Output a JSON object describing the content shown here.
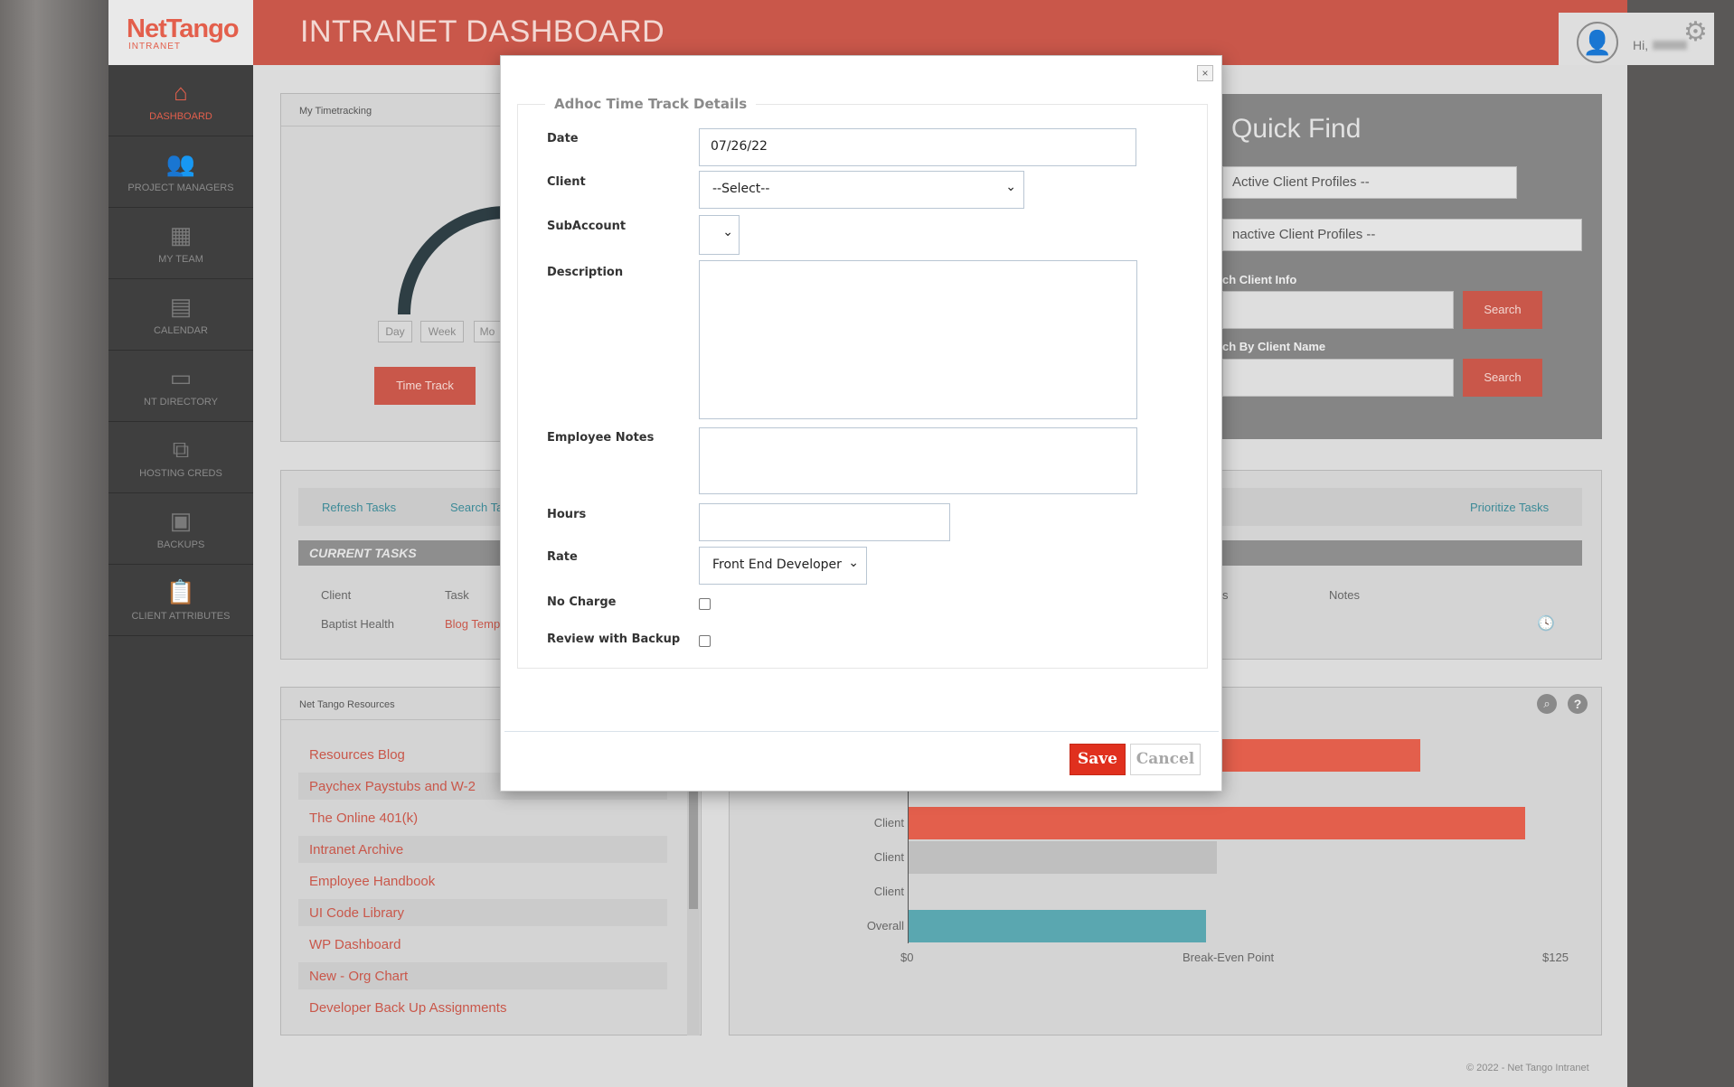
{
  "brand": {
    "logo": "NetTango",
    "logo_sub": "INTRANET"
  },
  "header": {
    "title": "INTRANET DASHBOARD",
    "greeting": "Hi,"
  },
  "sidebar": {
    "items": [
      {
        "label": "DASHBOARD",
        "icon": "home-icon"
      },
      {
        "label": "PROJECT MANAGERS",
        "icon": "people-icon"
      },
      {
        "label": "MY TEAM",
        "icon": "grid-icon"
      },
      {
        "label": "CALENDAR",
        "icon": "calendar-icon"
      },
      {
        "label": "NT DIRECTORY",
        "icon": "directory-icon"
      },
      {
        "label": "HOSTING CREDS",
        "icon": "network-icon"
      },
      {
        "label": "BACKUPS",
        "icon": "save-icon"
      },
      {
        "label": "CLIENT ATTRIBUTES",
        "icon": "clipboard-icon"
      }
    ]
  },
  "timetracking": {
    "title": "My Timetracking",
    "filters": [
      "Day",
      "Week",
      "Mo"
    ],
    "time_track_button": "Time Track"
  },
  "quick_find": {
    "title": "Quick Find",
    "active_select": "Active Client Profiles --",
    "inactive_select": "nactive Client Profiles --",
    "search_info_label": "ch Client Info",
    "search_name_label": "ch By Client Name",
    "search_button": "Search"
  },
  "tasks": {
    "refresh": "Refresh Tasks",
    "search": "Search Ta",
    "prioritize": "Prioritize Tasks",
    "current_title": "CURRENT TASKS",
    "columns": [
      "Client",
      "Task",
      "s",
      "Notes"
    ],
    "row": {
      "client": "Baptist Health",
      "task": "Blog Temp"
    }
  },
  "resources": {
    "title": "Net Tango Resources",
    "links": [
      "Resources Blog",
      "Paychex Paystubs and W-2",
      "The Online 401(k)",
      "Intranet Archive",
      "Employee Handbook",
      "UI Code Library",
      "WP Dashboard",
      "New - Org Chart",
      "Developer Back Up Assignments"
    ]
  },
  "chart_data": {
    "type": "bar",
    "orientation": "horizontal",
    "categories": [
      "Client",
      "Client",
      "Client",
      "Overall"
    ],
    "values": [
      118,
      59,
      0,
      57
    ],
    "top_bar_partial_value": 98,
    "colors": [
      "#e35f4c",
      "#bfbfbf",
      "#bfbfbf",
      "#5aa7b0"
    ],
    "x_tick_labels": [
      "$0",
      "Break-Even Point",
      "$125"
    ],
    "xlim": [
      0,
      125
    ]
  },
  "footer": {
    "copyright": "© 2022 - Net Tango Intranet"
  },
  "modal": {
    "legend": "Adhoc Time Track Details",
    "close": "×",
    "labels": {
      "date": "Date",
      "client": "Client",
      "subaccount": "SubAccount",
      "description": "Description",
      "employee_notes": "Employee Notes",
      "hours": "Hours",
      "rate": "Rate",
      "no_charge": "No Charge",
      "review_backup": "Review with Backup"
    },
    "values": {
      "date": "07/26/22",
      "client": "--Select--",
      "subaccount": "",
      "description": "",
      "employee_notes": "",
      "hours": "",
      "rate": "Front End Developer"
    },
    "save": "Save",
    "cancel": "Cancel"
  },
  "colors": {
    "accent": "#e35f4c",
    "save": "#e0301e",
    "teal": "#5aa7b0"
  }
}
